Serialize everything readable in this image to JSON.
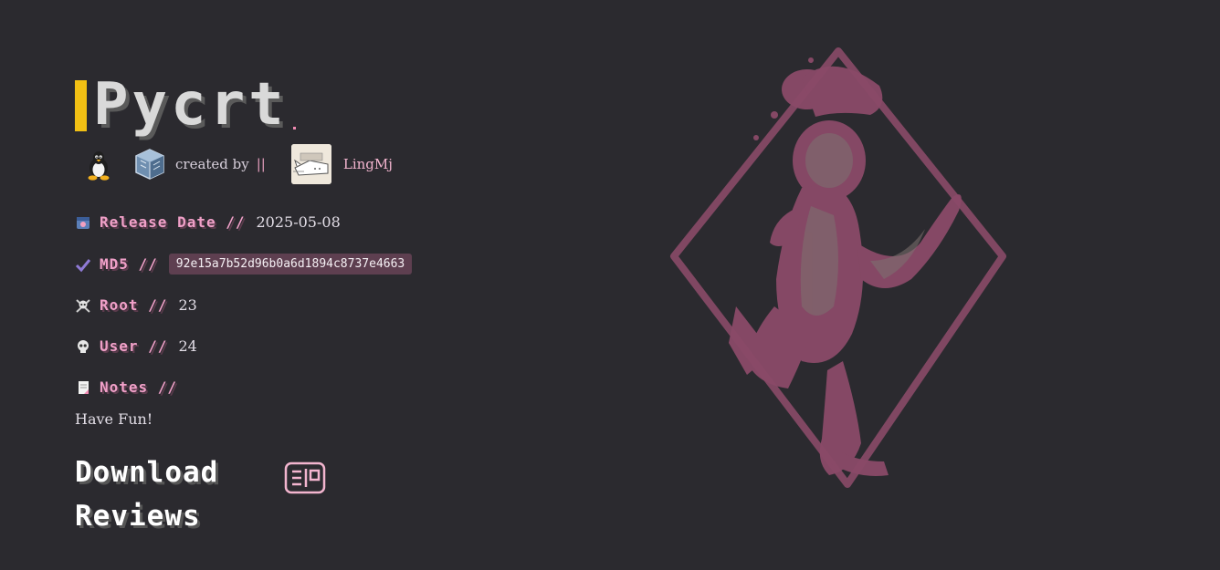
{
  "title": "Pycrt",
  "meta": {
    "platform_icons": [
      "linux-tux-icon",
      "virtualbox-icon"
    ],
    "created_by_label": "created by",
    "separator": "||",
    "author": "LingMj"
  },
  "fields": {
    "release": {
      "icon": "calendar-icon",
      "label": "Release Date //",
      "value": "2025-05-08"
    },
    "md5": {
      "icon": "checkmark-icon",
      "label": "MD5 //",
      "value": "92e15a7b52d96b0a6d1894c8737e4663"
    },
    "root": {
      "icon": "skull-crossbones-icon",
      "label": "Root //",
      "value": "23"
    },
    "user": {
      "icon": "skull-icon",
      "label": "User //",
      "value": "24"
    },
    "notes": {
      "icon": "memo-icon",
      "label": "Notes //",
      "value": "Have Fun!"
    }
  },
  "links": {
    "download": "Download",
    "reviews": "Reviews"
  },
  "colors": {
    "background": "#2b2a2f",
    "accent_pink": "#f0a0c8",
    "title_bar_yellow": "#f2c014",
    "md5_badge": "#5e3f50",
    "logo": "#8a4a68"
  }
}
